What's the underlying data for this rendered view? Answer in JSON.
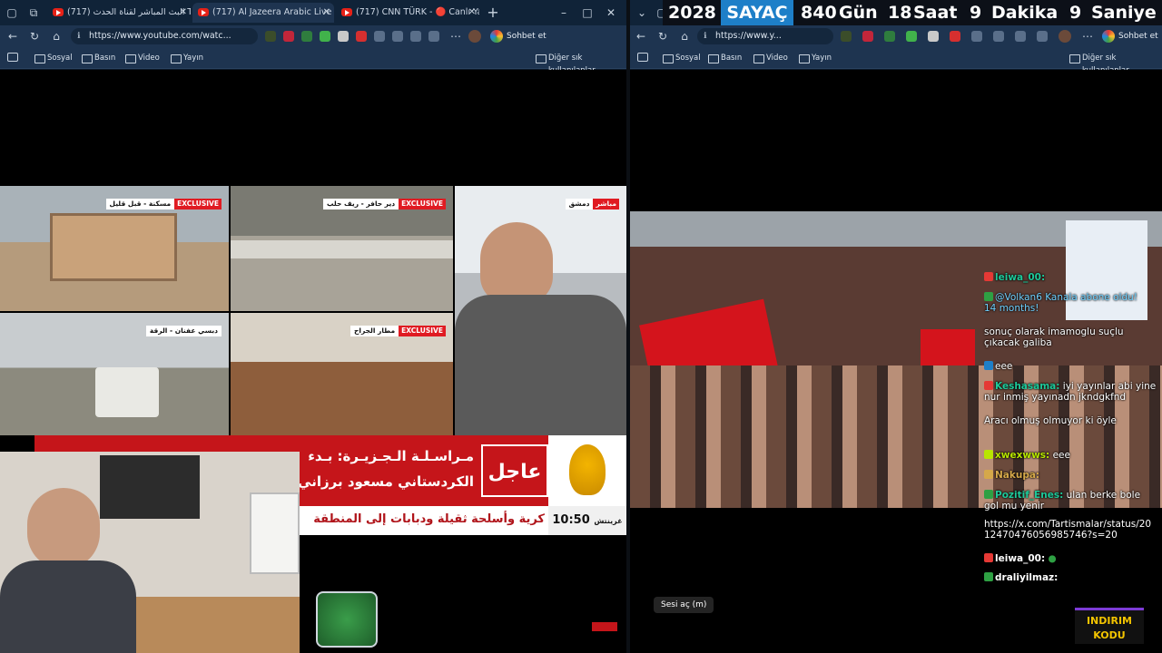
{
  "left_window": {
    "tabs": [
      {
        "title": "البث المباشر لقناة الحدث (717) Tube"
      },
      {
        "title": "(717) Al Jazeera Arabic Live ..."
      },
      {
        "title": "(717) CNN TÜRK - 🔴 Canlı Yayın"
      }
    ],
    "url": "https://www.youtube.com/watc...",
    "chat_button": "Sohbet et",
    "bookmarks": [
      "Sosyal",
      "Basın",
      "Video",
      "Yayın"
    ],
    "other_bookmarks": "Diğer sık kullanılanlar"
  },
  "right_window": {
    "url": "https://www.y...",
    "chat_button": "Sohbet et",
    "bookmarks": [
      "Sosyal",
      "Basın",
      "Video",
      "Yayın"
    ],
    "other_bookmarks": "Diğer sık kullanılanlar",
    "unmute_label": "Sesi aç (m)"
  },
  "counter": {
    "year": "2028",
    "label": "SAYAÇ",
    "days": "840",
    "days_unit": "Gün",
    "hours": "18",
    "hours_unit": "Saat",
    "minutes": "9",
    "minutes_unit": "Dakika",
    "seconds": "9",
    "seconds_unit": "Saniye"
  },
  "news": {
    "tiles": [
      {
        "location": "مسكنة - قبل قليل",
        "tag": "EXCLUSIVE"
      },
      {
        "location": "دير حافر - ريف حلب",
        "tag": "EXCLUSIVE"
      },
      {
        "location": "دمشق",
        "tag": "مباشر"
      },
      {
        "location": "دبسي عفنان - الرقة",
        "tag": ""
      },
      {
        "location": "مطار الجراح",
        "tag": "EXCLUSIVE"
      }
    ],
    "breaking": "عاجل",
    "headline_1": "مـراسـلـة الـجـزيـرة: بـدء",
    "headline_2": "الكردستاني مسعود برزاني",
    "bottom_line": "كرية وأسلحة ثقيلة ودبابات إلى المنطقة",
    "time": "10:50",
    "time_label": "غرينتش"
  },
  "chat": [
    {
      "user": "leiwa_00:",
      "msg": "",
      "color": "#1ec99a"
    },
    {
      "user": "",
      "msg": "@Volkan6 Kanala abone oldu! 14 months!",
      "color": "#6fd1ff"
    },
    {
      "user": "",
      "msg": "sonuç olarak imamoglu suçlu çıkacak galiba",
      "color": "#c28cff"
    },
    {
      "user": "",
      "msg": "eee",
      "color": "#6fd1ff"
    },
    {
      "user": "Keshasama:",
      "msg": "iyi yayınlar abi yine nur inmiş yayınadn jkndgkfnd",
      "color": "#1ec99a"
    },
    {
      "user": "",
      "msg": "Aracı olmuş olmuyor ki öyle",
      "color": "#6fd1ff"
    },
    {
      "user": "xwexwws:",
      "msg": "eee",
      "color": "#b8e600"
    },
    {
      "user": "Nakupa:",
      "msg": "",
      "color": "#d5a84a"
    },
    {
      "user": "Pozitif_Enes:",
      "msg": "ulan berke bole gol mu yenir",
      "color": "#1ec99a"
    },
    {
      "user": "",
      "msg": "https://x.com/Tartismalar/status/2012470476056985746?s=20",
      "color": "#fff"
    },
    {
      "user": "leiwa_00:",
      "msg": "",
      "color": "#1ec99a"
    },
    {
      "user": "draliyilmaz:",
      "msg": "",
      "color": "#1ec99a"
    }
  ],
  "promo": "INDIRIM KODU",
  "colors": {
    "chrome": "#1e3450",
    "tabbar": "#102338",
    "aj_red": "#c5151a",
    "aj_gold": "#f3b400",
    "counter_blue": "#1e7fc8"
  }
}
